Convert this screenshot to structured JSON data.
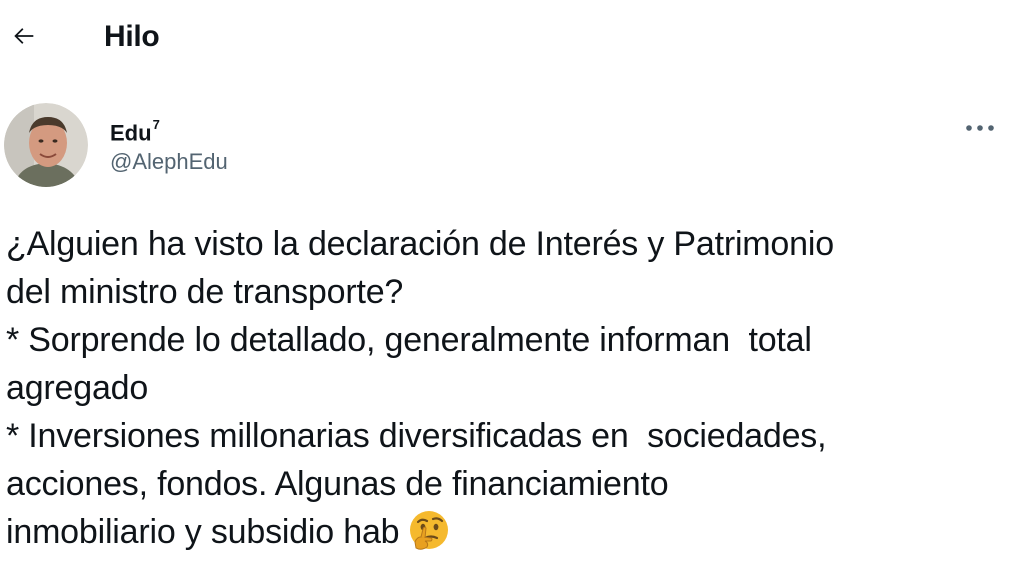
{
  "header": {
    "title": "Hilo",
    "back_icon": "arrow-left-icon"
  },
  "author": {
    "display_name": "Edu",
    "display_name_superscript": "7",
    "handle": "@AlephEdu",
    "avatar_icon": "user-avatar",
    "more_icon": "more-horizontal-icon"
  },
  "tweet": {
    "lines": [
      "¿Alguien ha visto la declaración de Interés y Patrimonio",
      "del ministro de transporte?",
      "* Sorprende lo detallado, generalmente informan  total",
      "agregado",
      "* Inversiones millonarias diversificadas en  sociedades,",
      "acciones, fondos. Algunas de financiamiento",
      "inmobiliario y subsidio hab"
    ],
    "trailing_emoji": "thinking-face-icon"
  },
  "colors": {
    "text_primary": "#0f1419",
    "text_secondary": "#536471",
    "emoji_face": "#f5b92e",
    "emoji_hand": "#e8a020"
  }
}
